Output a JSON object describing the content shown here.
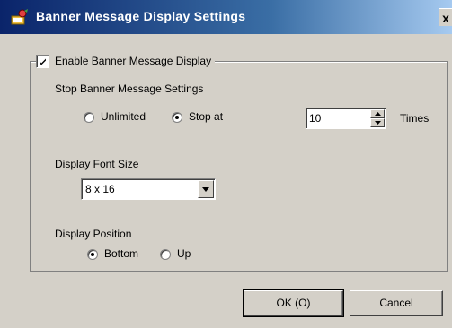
{
  "window": {
    "title": "Banner Message Display Settings",
    "close_label": "x"
  },
  "group": {
    "enable_label": "Enable Banner Message Display",
    "enable_checked": true
  },
  "stop_settings": {
    "heading": "Stop Banner Message Settings",
    "unlimited_label": "Unlimited",
    "stop_at_label": "Stop at",
    "selected": "stop_at",
    "times_value": "10",
    "times_label": "Times"
  },
  "font_size": {
    "heading": "Display Font Size",
    "selected": "8 x 16"
  },
  "position": {
    "heading": "Display Position",
    "bottom_label": "Bottom",
    "up_label": "Up",
    "selected": "bottom"
  },
  "buttons": {
    "ok_label": "OK (O)",
    "cancel_label": "Cancel"
  },
  "colors": {
    "titlebar_start": "#0a246a",
    "titlebar_end": "#a6caf0",
    "dialog_face": "#d4d0c8"
  },
  "icons": {
    "title": "app-settings-icon",
    "close": "close-icon",
    "checkbox": "checkmark-icon",
    "spin_up": "arrow-up-icon",
    "spin_down": "arrow-down-icon",
    "dropdown": "chevron-down-icon"
  }
}
